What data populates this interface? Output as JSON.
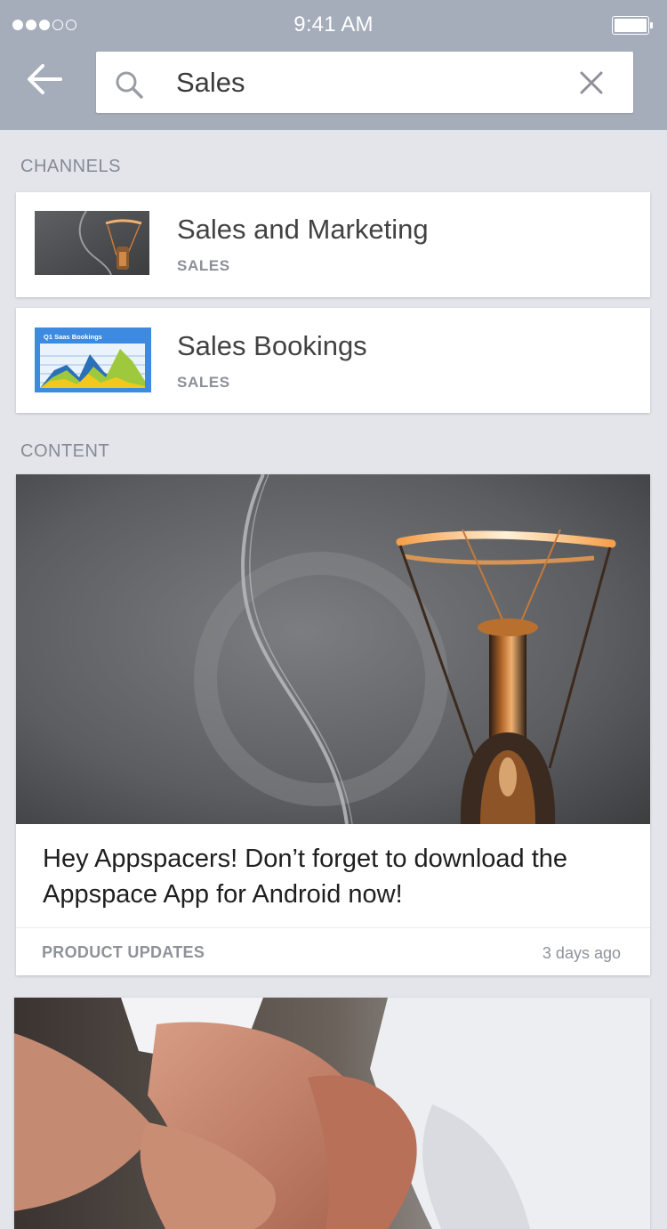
{
  "status_bar": {
    "time": "9:41 AM",
    "signal_filled": 3,
    "signal_total": 5,
    "battery_level": 1.0
  },
  "search": {
    "value": "Sales",
    "icons": {
      "back": "arrow-left-icon",
      "search": "search-icon",
      "clear": "close-icon"
    }
  },
  "sections": {
    "channels_label": "CHANNELS",
    "content_label": "CONTENT"
  },
  "channels": [
    {
      "title": "Sales and Marketing",
      "category": "SALES",
      "thumbnail": "lightbulb-image"
    },
    {
      "title": "Sales Bookings",
      "category": "SALES",
      "thumbnail": "chart-image",
      "thumbnail_text": "Q1 Saas Bookings"
    }
  ],
  "content": [
    {
      "headline": "Hey Appspacers! Don’t forget to download the Appspace App for Android now!",
      "category": "PRODUCT UPDATES",
      "time": "3 days ago",
      "image": "lightbulb-image"
    },
    {
      "image": "handshake-image"
    }
  ],
  "colors": {
    "header_bg": "#a5acba",
    "page_bg": "#e4e5eb",
    "card_bg": "#ffffff",
    "muted_text": "#858b96"
  }
}
